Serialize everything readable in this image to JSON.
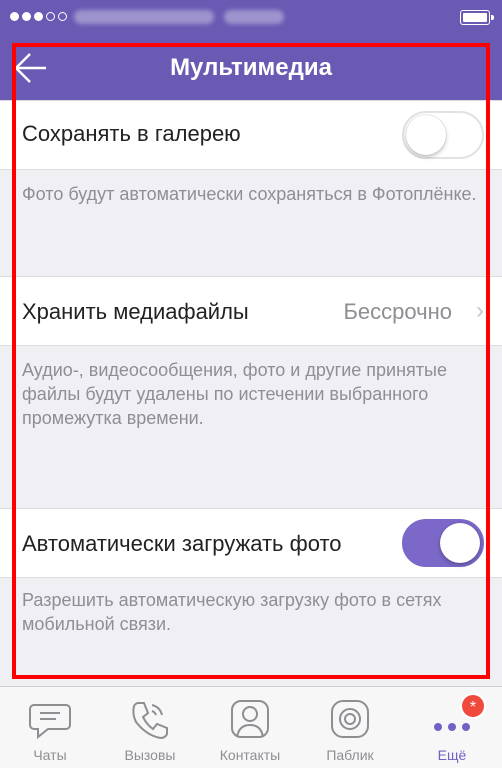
{
  "nav": {
    "title": "Мультимедиа"
  },
  "rows": {
    "save_gallery": {
      "label": "Сохранять в галерею",
      "toggle": "off"
    },
    "save_gallery_note": "Фото будут автоматически сохраняться в Фотоплёнке.",
    "keep_media": {
      "label": "Хранить медиафайлы",
      "value": "Бессрочно"
    },
    "keep_media_note": "Аудио-, видеосообщения, фото и другие принятые файлы будут удалены по истечении выбранного промежутка времени.",
    "auto_download": {
      "label": "Автоматически загружать фото",
      "toggle": "on"
    },
    "auto_download_note": "Разрешить автоматическую загрузку фото в сетях мобильной связи."
  },
  "tabs": [
    {
      "label": "Чаты",
      "icon": "chat-bubble-icon"
    },
    {
      "label": "Вызовы",
      "icon": "phone-icon"
    },
    {
      "label": "Контакты",
      "icon": "contacts-icon"
    },
    {
      "label": "Паблик",
      "icon": "public-icon"
    },
    {
      "label": "Ещё",
      "icon": "more-dots-icon",
      "badge": "*"
    }
  ],
  "colors": {
    "brand": "#6a5ab4",
    "toggle_on": "#7b68c8",
    "badge": "#f04a3d",
    "annotation": "#ff0000"
  }
}
